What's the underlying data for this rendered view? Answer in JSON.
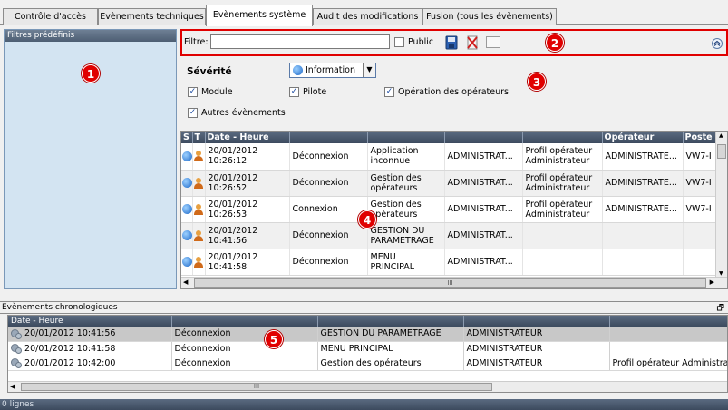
{
  "tabs": [
    {
      "label": "Contrôle d'accès",
      "active": false
    },
    {
      "label": "Evènements techniques",
      "active": false
    },
    {
      "label": "Evènements système",
      "active": true
    },
    {
      "label": "Audit des modifications",
      "active": false
    },
    {
      "label": "Fusion (tous les évènements)",
      "active": false
    }
  ],
  "left_panel": {
    "title": "Filtres prédéfinis"
  },
  "markers": [
    "1",
    "2",
    "3",
    "4",
    "5"
  ],
  "filter": {
    "label": "Filtre:",
    "value": "",
    "public_label": "Public",
    "public_checked": false
  },
  "severity": {
    "label": "Sévérité",
    "selected": "Information"
  },
  "checkboxes": [
    {
      "label": "Module",
      "checked": true
    },
    {
      "label": "Pilote",
      "checked": true
    },
    {
      "label": "Opération des opérateurs",
      "checked": true
    },
    {
      "label": "Autres évènements",
      "checked": true
    }
  ],
  "grid": {
    "columns": [
      "S",
      "T",
      "Date - Heure",
      "",
      "",
      "",
      "",
      "Opérateur",
      "Poste"
    ],
    "rows": [
      {
        "date": "20/01/2012",
        "time": "10:26:12",
        "action": "Déconnexion",
        "module1": "Application",
        "module2": "inconnue",
        "user": "ADMINISTRAT...",
        "profile1": "Profil opérateur",
        "profile2": "Administrateur",
        "operator": "ADMINISTRATE...",
        "poste": "VW7-I"
      },
      {
        "date": "20/01/2012",
        "time": "10:26:52",
        "action": "Déconnexion",
        "module1": "Gestion des",
        "module2": "opérateurs",
        "user": "ADMINISTRAT...",
        "profile1": "Profil opérateur",
        "profile2": "Administrateur",
        "operator": "ADMINISTRATE...",
        "poste": "VW7-I"
      },
      {
        "date": "20/01/2012",
        "time": "10:26:53",
        "action": "Connexion",
        "module1": "Gestion des",
        "module2": "opérateurs",
        "user": "ADMINISTRAT...",
        "profile1": "Profil opérateur",
        "profile2": "Administrateur",
        "operator": "ADMINISTRATE...",
        "poste": "VW7-I"
      },
      {
        "date": "20/01/2012",
        "time": "10:41:56",
        "action": "Déconnexion",
        "module1": "GESTION DU",
        "module2": "PARAMETRAGE",
        "user": "ADMINISTRAT...",
        "profile1": "",
        "profile2": "",
        "operator": "",
        "poste": ""
      },
      {
        "date": "20/01/2012",
        "time": "10:41:58",
        "action": "Déconnexion",
        "module1": "MENU",
        "module2": "PRINCIPAL",
        "user": "ADMINISTRAT...",
        "profile1": "",
        "profile2": "",
        "operator": "",
        "poste": ""
      }
    ]
  },
  "chrono": {
    "title": "Evènements chronologiques",
    "header": "Date - Heure",
    "rows": [
      {
        "datetime": "20/01/2012 10:41:56",
        "action": "Déconnexion",
        "module": "GESTION DU PARAMETRAGE",
        "user": "ADMINISTRATEUR",
        "profile": ""
      },
      {
        "datetime": "20/01/2012 10:41:58",
        "action": "Déconnexion",
        "module": "MENU PRINCIPAL",
        "user": "ADMINISTRATEUR",
        "profile": ""
      },
      {
        "datetime": "20/01/2012 10:42:00",
        "action": "Déconnexion",
        "module": "Gestion des opérateurs",
        "user": "ADMINISTRATEUR",
        "profile": "Profil opérateur Administra"
      }
    ]
  },
  "status": {
    "text": "0 lignes"
  },
  "scroll_glyph": "III"
}
